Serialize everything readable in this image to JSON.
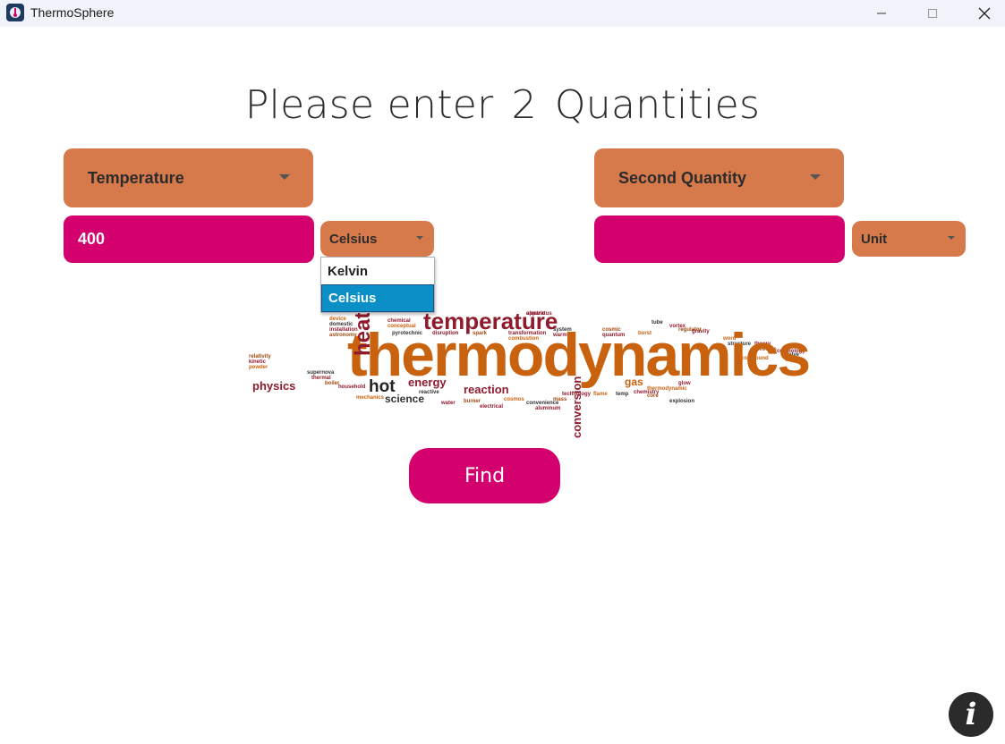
{
  "window": {
    "title": "ThermoSphere",
    "controls": {
      "minimize": "—",
      "maximize": "☐",
      "close": "✕"
    }
  },
  "header": {
    "prefix": "Please enter",
    "count": "2",
    "suffix": "Quantities"
  },
  "left": {
    "quantity": "Temperature",
    "value": "400",
    "unit": "Celsius"
  },
  "right": {
    "quantity": "Second Quantity",
    "value": "",
    "unit": "Unit"
  },
  "unit_dropdown": {
    "options": [
      "Kelvin",
      "Celsius"
    ],
    "selected": "Celsius"
  },
  "wordcloud": {
    "main": "thermodynamics",
    "large": [
      "temperature",
      "heat",
      "hot",
      "energy",
      "reaction",
      "physics",
      "science",
      "gas",
      "conversion"
    ],
    "small": [
      "electric",
      "device",
      "domestic",
      "installation",
      "astronomy",
      "chemical",
      "conceptual",
      "pyrotechnic",
      "disruption",
      "spark",
      "transformation",
      "combustion",
      "system",
      "warming",
      "cosmic",
      "quantum",
      "burst",
      "tube",
      "vortex",
      "regulator",
      "gravity",
      "word",
      "structure",
      "theory",
      "universe",
      "cosmology",
      "compound",
      "valve",
      "heater",
      "relativity",
      "kinetic",
      "powder",
      "supernova",
      "thermal",
      "boiler",
      "household",
      "mechanics",
      "reactive",
      "water",
      "burner",
      "electrical",
      "cosmos",
      "convenience",
      "aluminum",
      "mass",
      "technology",
      "flame",
      "temp",
      "chemistry",
      "core",
      "glow",
      "thermodynamic",
      "explosion",
      "apparatus"
    ]
  },
  "find_button": "Find",
  "info_button": "i",
  "colors": {
    "orange": "#d67a4c",
    "magenta": "#d4006e",
    "selected_blue": "#0a8fc7",
    "wordcloud_orange": "#c8620f",
    "wordcloud_red": "#8f1b2d"
  }
}
